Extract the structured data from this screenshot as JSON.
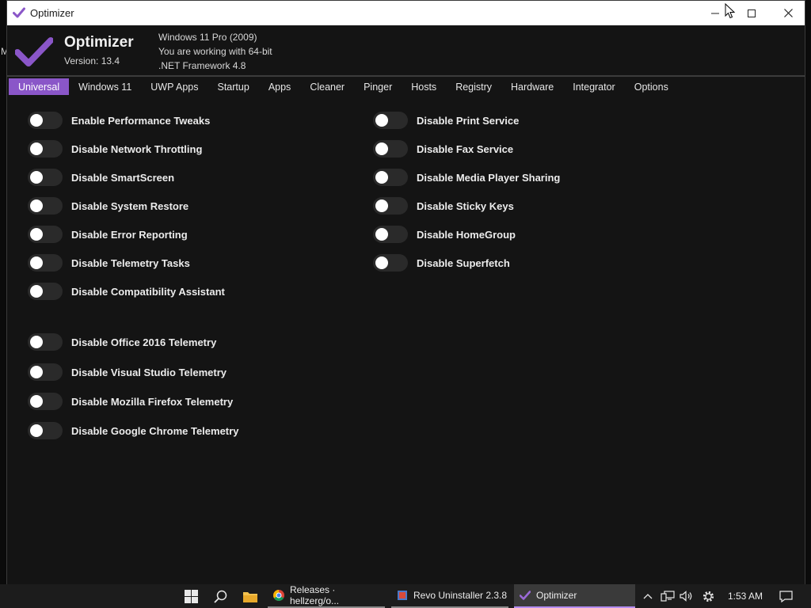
{
  "desktop": {
    "stub_text": "M"
  },
  "window": {
    "title": "Optimizer",
    "controls": {
      "minimize": "minimize",
      "maximize": "maximize",
      "close": "close"
    }
  },
  "header": {
    "app_name": "Optimizer",
    "version": "Version: 13.4",
    "os": "Windows 11 Pro (2009)",
    "bitness": "You are working with 64-bit",
    "framework": ".NET Framework 4.8"
  },
  "tabs": [
    {
      "label": "Universal",
      "active": true
    },
    {
      "label": "Windows 11",
      "active": false
    },
    {
      "label": "UWP Apps",
      "active": false
    },
    {
      "label": "Startup",
      "active": false
    },
    {
      "label": "Apps",
      "active": false
    },
    {
      "label": "Cleaner",
      "active": false
    },
    {
      "label": "Pinger",
      "active": false
    },
    {
      "label": "Hosts",
      "active": false
    },
    {
      "label": "Registry",
      "active": false
    },
    {
      "label": "Hardware",
      "active": false
    },
    {
      "label": "Integrator",
      "active": false
    },
    {
      "label": "Options",
      "active": false
    }
  ],
  "options_left": [
    {
      "label": "Enable Performance Tweaks",
      "on": false
    },
    {
      "label": "Disable Network Throttling",
      "on": false
    },
    {
      "label": "Disable SmartScreen",
      "on": false
    },
    {
      "label": "Disable System Restore",
      "on": false
    },
    {
      "label": "Disable Error Reporting",
      "on": false
    },
    {
      "label": "Disable Telemetry Tasks",
      "on": false
    },
    {
      "label": "Disable Compatibility Assistant",
      "on": false
    }
  ],
  "options_right": [
    {
      "label": "Disable Print Service",
      "on": false
    },
    {
      "label": "Disable Fax Service",
      "on": false
    },
    {
      "label": "Disable Media Player Sharing",
      "on": false
    },
    {
      "label": "Disable Sticky Keys",
      "on": false
    },
    {
      "label": "Disable HomeGroup",
      "on": false
    },
    {
      "label": "Disable Superfetch",
      "on": false
    }
  ],
  "options_telemetry": [
    {
      "label": "Disable Office 2016 Telemetry",
      "on": false
    },
    {
      "label": "Disable Visual Studio Telemetry",
      "on": false
    },
    {
      "label": "Disable Mozilla Firefox Telemetry",
      "on": false
    },
    {
      "label": "Disable Google Chrome Telemetry",
      "on": false
    }
  ],
  "taskbar": {
    "apps": [
      {
        "label": "Releases · hellzerg/o...",
        "icon": "chrome-icon",
        "active": false
      },
      {
        "label": "Revo Uninstaller 2.3.8",
        "icon": "revo-uninstaller-icon",
        "active": false
      },
      {
        "label": "Optimizer",
        "icon": "optimizer-icon",
        "active": true
      }
    ],
    "clock": "1:53 AM"
  },
  "colors": {
    "accent": "#8a56c8",
    "background": "#141414",
    "toggle_off": "#2a2a2a",
    "titlebar": "#ffffff"
  }
}
